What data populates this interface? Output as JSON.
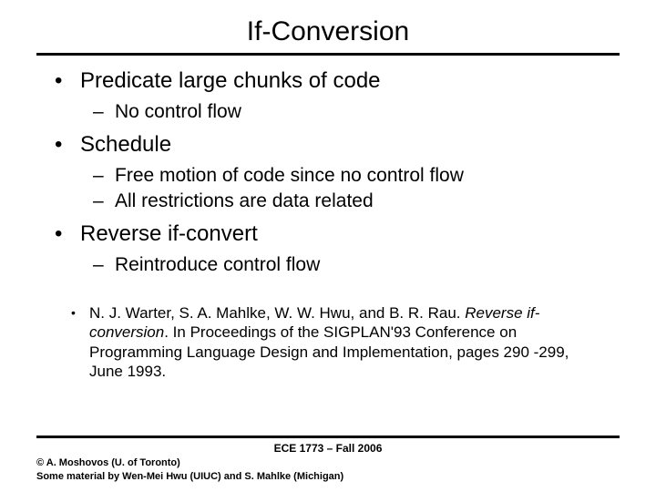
{
  "title": "If-Conversion",
  "bullets": {
    "b1a": "Predicate large chunks of code",
    "b1a_sub1": "No control flow",
    "b1b": "Schedule",
    "b1b_sub1": "Free motion of code since no control flow",
    "b1b_sub2": "All restrictions are data related",
    "b1c": "Reverse if-convert",
    "b1c_sub1": "Reintroduce control flow"
  },
  "reference": {
    "authors": "N. J. Warter, S. A. Mahlke, W. W. Hwu, and B. R. Rau. ",
    "title_italic": "Reverse if-conversion",
    "rest": ". In Proceedings of the SIGPLAN'93 Conference on Programming Language Design and Implementation, pages 290 -299, June 1993."
  },
  "footer": {
    "center": "ECE 1773 – Fall 2006",
    "line1": "© A. Moshovos (U. of Toronto)",
    "line2": "Some material by Wen-Mei Hwu (UIUC) and S. Mahlke (Michigan)"
  }
}
